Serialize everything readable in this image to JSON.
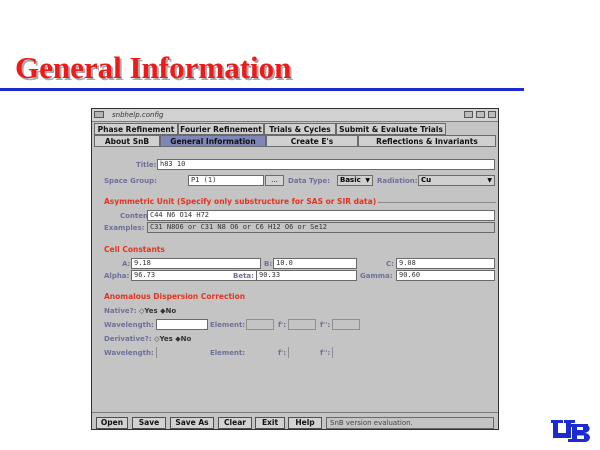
{
  "slide": {
    "title": "General Information"
  },
  "window": {
    "title": "snbhelp.config",
    "tabs_row1": [
      "Phase Refinement",
      "Fourier Refinement",
      "Trials & Cycles",
      "Submit & Evaluate Trials"
    ],
    "tabs_row2": [
      "About SnB",
      "General Information",
      "Create E's",
      "Reflections & Invariants"
    ],
    "active_tab": "General Information"
  },
  "general": {
    "title_label": "Title:",
    "title_value": "h83 10",
    "space_group_label": "Space Group:",
    "space_group_value": "P1 (1)",
    "space_group_button": "...",
    "data_type_label": "Data Type:",
    "data_type_value": "Basic",
    "radiation_label": "Radiation:",
    "radiation_value": "Cu"
  },
  "asymmetric": {
    "heading": "Asymmetric Unit (Specify only substructure for SAS or SIR data)",
    "contents_label": "Contents:",
    "contents_value": "C44 N6 O14 H72",
    "examples_label": "Examples:",
    "examples_value": "C31 N8O6 or C31 N8 O6 or C6 H12 O6 or Se12"
  },
  "cell": {
    "heading": "Cell Constants",
    "a_label": "A:",
    "a_value": "9.18",
    "b_label": "B:",
    "b_value": "10.0",
    "c_label": "C:",
    "c_value": "9.08",
    "alpha_label": "Alpha:",
    "alpha_value": "96.73",
    "beta_label": "Beta:",
    "beta_value": "90.33",
    "gamma_label": "Gamma:",
    "gamma_value": "90.60"
  },
  "anomalous": {
    "heading": "Anomalous Dispersion Correction",
    "native_label": "Native?:",
    "derivative_label": "Derivative?:",
    "yes": "Yes",
    "no": "No",
    "wavelength_label": "Wavelength:",
    "element_label": "Element:",
    "fp_label": "f':",
    "fpp_label": "f'':"
  },
  "footer": {
    "buttons": [
      "Open",
      "Save",
      "Save As",
      "Clear",
      "Exit",
      "Help"
    ],
    "status": "SnB version evaluation."
  }
}
